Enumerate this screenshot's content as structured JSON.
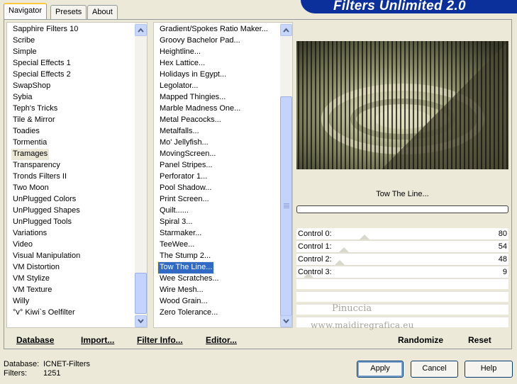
{
  "tabs": [
    {
      "label": "Navigator"
    },
    {
      "label": "Presets"
    },
    {
      "label": "About"
    }
  ],
  "banner": {
    "title": "Filters Unlimited 2.0"
  },
  "categories": {
    "items": [
      "Sapphire Filters 10",
      "Scribe",
      "Simple",
      "Special Effects 1",
      "Special Effects 2",
      "SwapShop",
      "Sybia",
      "Teph's Tricks",
      "Tile & Mirror",
      "Toadies",
      "Tormentia",
      "Tramages",
      "Transparency",
      "Tronds Filters II",
      "Two Moon",
      "UnPlugged Colors",
      "UnPlugged Shapes",
      "UnPlugged Tools",
      "Variations",
      "Video",
      "Visual Manipulation",
      "VM Distortion",
      "VM Stylize",
      "VM Texture",
      "Willy",
      "°v° Kiwi`s Oelfilter"
    ],
    "selected": "Tramages"
  },
  "filters": {
    "items": [
      "Gradient/Spokes Ratio Maker...",
      "Groovy Bachelor Pad...",
      "Heightline...",
      "Hex Lattice...",
      "Holidays in Egypt...",
      "Legolator...",
      "Mapped Thingies...",
      "Marble Madness One...",
      "Metal Peacocks...",
      "Metalfalls...",
      "Mo' Jellyfish...",
      "MovingScreen...",
      "Panel Stripes...",
      "Perforator 1...",
      "Pool Shadow...",
      "Print Screen...",
      "Quilt......",
      "Spiral 3...",
      "Starmaker...",
      "TeeWee...",
      "The Stump 2...",
      "Tow The Line...",
      "Wee Scratches...",
      "Wire Mesh...",
      "Wood Grain...",
      "Zero Tolerance..."
    ],
    "selected": "Tow The Line..."
  },
  "preview": {
    "filter_name": "Tow The Line...",
    "progress": 0
  },
  "controls": [
    {
      "label": "Control 0:",
      "value": "80",
      "level": 80
    },
    {
      "label": "Control 1:",
      "value": "54",
      "level": 54
    },
    {
      "label": "Control 2:",
      "value": "48",
      "level": 48
    },
    {
      "label": "Control 3:",
      "value": "9",
      "level": 9
    }
  ],
  "watermark": {
    "line1": "Pinuccia",
    "line2": "www.maidiregrafica.eu"
  },
  "bottom_links": {
    "database": "Database",
    "import": "Import...",
    "filter_info": "Filter Info...",
    "editor": "Editor...",
    "randomize": "Randomize",
    "reset": "Reset"
  },
  "status": {
    "database_label": "Database:",
    "database_value": "ICNET-Filters",
    "filters_label": "Filters:",
    "filters_value": "1251"
  },
  "buttons": {
    "apply": "Apply",
    "cancel": "Cancel",
    "help": "Help"
  },
  "colors": {
    "banner": "#0b2f9b",
    "selection": "#316ac5",
    "tab_highlight": "#ffc83c"
  }
}
